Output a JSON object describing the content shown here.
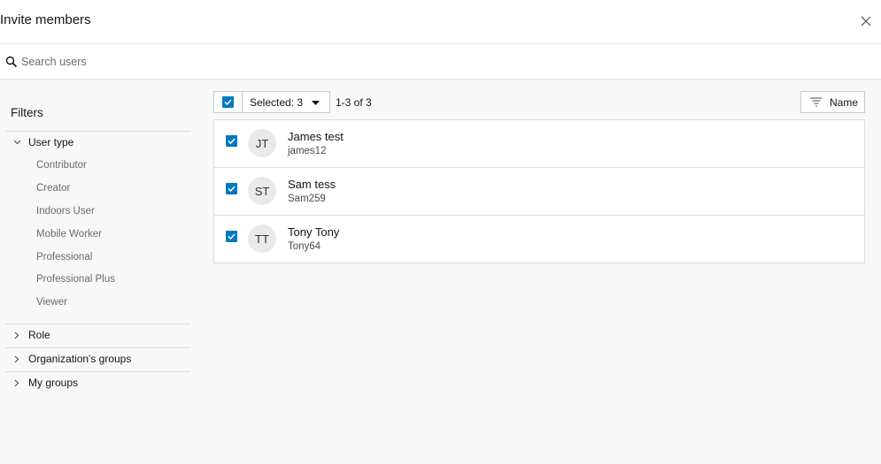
{
  "header": {
    "title": "Invite members"
  },
  "search": {
    "placeholder": "Search users",
    "value": ""
  },
  "filters": {
    "title": "Filters",
    "groups": [
      {
        "label": "User type",
        "expanded": true,
        "options": [
          "Contributor",
          "Creator",
          "Indoors User",
          "Mobile Worker",
          "Professional",
          "Professional Plus",
          "Viewer"
        ]
      },
      {
        "label": "Role",
        "expanded": false
      },
      {
        "label": "Organization's groups",
        "expanded": false
      },
      {
        "label": "My groups",
        "expanded": false
      }
    ]
  },
  "toolbar": {
    "selected_label": "Selected: 3",
    "count_label": "1-3 of 3",
    "sort_label": "Name"
  },
  "users": [
    {
      "initials": "JT",
      "name": "James test",
      "username": "james12",
      "checked": true
    },
    {
      "initials": "ST",
      "name": "Sam tess",
      "username": "Sam259",
      "checked": true
    },
    {
      "initials": "TT",
      "name": "Tony Tony",
      "username": "Tony64",
      "checked": true
    }
  ],
  "colors": {
    "accent": "#0079c1",
    "background": "#f8f8f8",
    "border": "#dcdcdc",
    "muted_text": "#6a6a6a"
  },
  "icons": {
    "close": "close-icon",
    "search": "search-icon",
    "checkbox": "checkmark-icon",
    "sort": "sort-lines-icon",
    "caret": "caret-down-icon"
  }
}
